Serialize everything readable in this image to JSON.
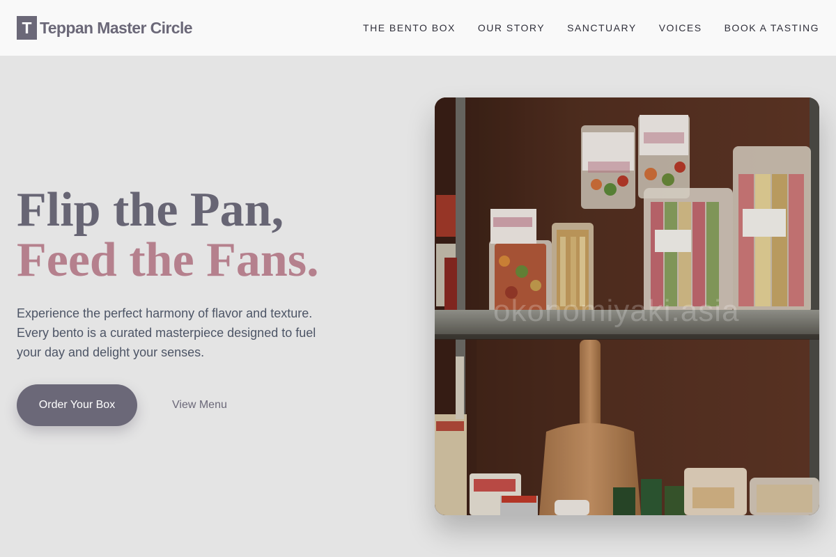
{
  "brand": {
    "mark": "T",
    "name": "Teppan Master Circle"
  },
  "nav": {
    "items": [
      {
        "label": "THE BENTO BOX"
      },
      {
        "label": "OUR STORY"
      },
      {
        "label": "SANCTUARY"
      },
      {
        "label": "VOICES"
      },
      {
        "label": "BOOK A TASTING"
      }
    ]
  },
  "hero": {
    "headline_line1": "Flip the Pan,",
    "headline_line2": "Feed the Fans.",
    "description": "Experience the perfect harmony of flavor and texture. Every bento is a curated masterpiece designed to fuel your day and delight your senses.",
    "primary_cta": "Order Your Box",
    "secondary_cta": "View Menu",
    "image": {
      "subject": "pantry-shelves-with-pasta-bags-and-pizza-peel",
      "watermark": "okonomiyaki.asia"
    }
  },
  "colors": {
    "accent": "#6b6878",
    "accent_pink": "#b5808d",
    "header_bg": "#f9f9f9",
    "page_bg": "#e4e4e4"
  }
}
